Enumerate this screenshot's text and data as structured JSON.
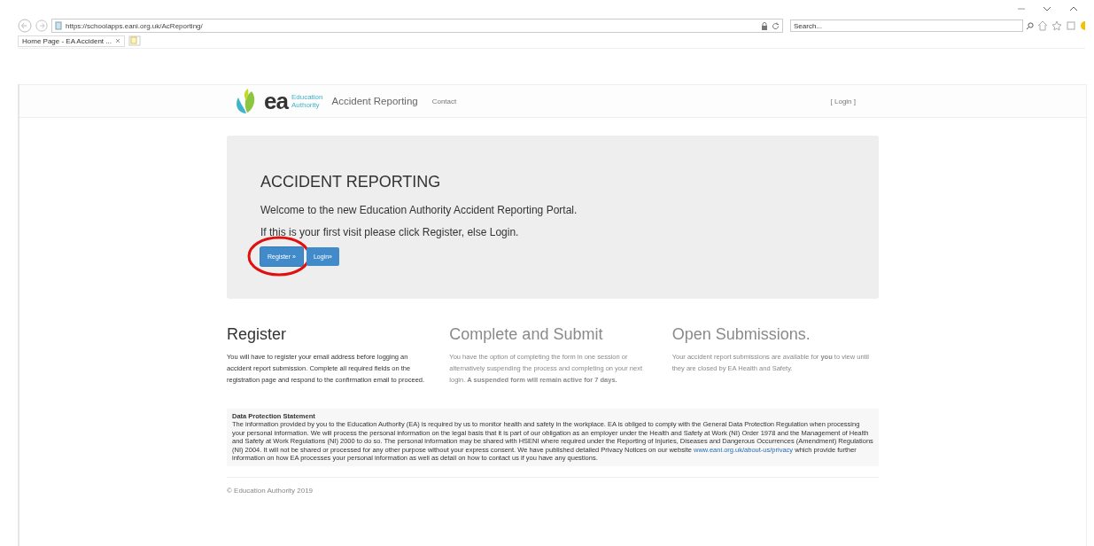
{
  "browser": {
    "url": "https://schoolapps.eani.org.uk/AcReporting/",
    "search_placeholder": "Search...",
    "tab_title": "Home Page - EA Accident ..."
  },
  "nav": {
    "logo_word": "ea",
    "logo_sub_1": "Education",
    "logo_sub_2": "Authority",
    "brand": "Accident Reporting",
    "links": [
      "Contact"
    ],
    "login": "[ Login ]"
  },
  "hero": {
    "title": "ACCIDENT REPORTING",
    "lines": [
      "Welcome to the new Education Authority Accident Reporting Portal.",
      "If this is your first visit please click Register, else Login."
    ],
    "buttons": [
      {
        "label": "Register »",
        "highlighted": true
      },
      {
        "label": "Login»",
        "highlighted": false
      }
    ]
  },
  "columns": [
    {
      "heading": "Register",
      "text": "You will have to register your email address before logging an accident report submission. Complete all required fields on the registration page and respond to the confirmation email to proceed.",
      "faded": false
    },
    {
      "heading": "Complete and Submit",
      "text": "You have the option of completing the form in one session or alternatively suspending the process and completing on your next login. **A suspended form will remain active for 7 days.**",
      "faded": true
    },
    {
      "heading": "Open Submissions.",
      "text": "Your accident report submissions are available for **you** to view until they are closed by EA Health and Safety.",
      "faded": true
    }
  ],
  "data_protection": {
    "heading": "Data Protection Statement",
    "text_before": "The information provided by you to the Education Authority (EA) is required by us to monitor health and safety in the workplace. EA is obliged to comply with the General Data Protection Regulation when processing your personal information. We will process the personal information on the legal basis that it is part of our obligation as an employer under the Health and Safety at Work (NI) Order 1978 and the Management of Health and Safety at Work Regulations (NI) 2000 to do so. The personal information may be shared with HSENI where required under the Reporting of Injuries, Diseases and Dangerous Occurrences (Amendment) Regulations (NI) 2004. It will not be shared or processed for any other purpose without your express consent. We have published detailed Privacy Notices on our website",
    "link": "www.eani.org.uk/about-us/privacy",
    "text_after": "which provide further information on how EA processes your personal information as well as detail on how to contact us if you have any questions."
  },
  "footer": "© Education Authority 2019"
}
